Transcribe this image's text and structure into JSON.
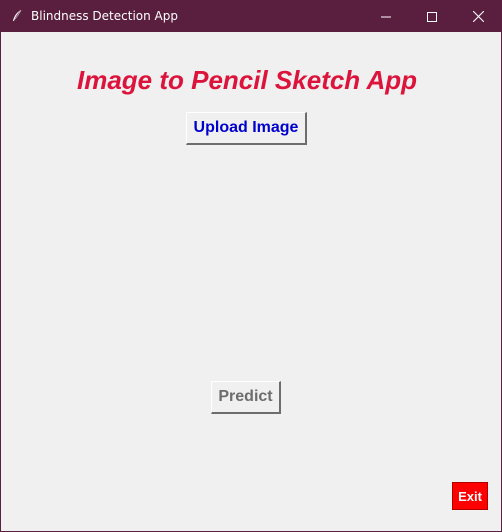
{
  "window": {
    "title": "Blindness Detection App",
    "app_icon": "feather-icon",
    "titlebar_color": "#5a1e3e",
    "controls": {
      "minimize": "minimize-icon",
      "maximize": "maximize-icon",
      "close": "close-icon"
    }
  },
  "main": {
    "heading": "Image to Pencil Sketch App",
    "heading_color": "#dc143c",
    "upload_label": "Upload Image",
    "upload_color": "#0000cd",
    "predict_label": "Predict",
    "exit_label": "Exit",
    "exit_color": "#ff0000"
  }
}
